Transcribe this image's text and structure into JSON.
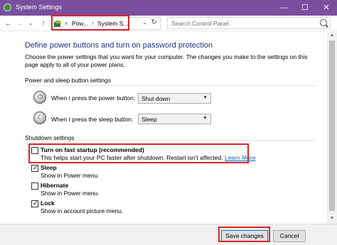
{
  "window": {
    "title": "System Settings",
    "minimize": "—",
    "maximize": "☐",
    "close": "✕"
  },
  "nav": {
    "back_icon": "←",
    "forward_icon": "→",
    "recent_icon": "⌄",
    "up_icon": "↑",
    "breadcrumb_prefix": "«",
    "crumbs": [
      "Pow...",
      "System S..."
    ],
    "separator": "›",
    "dropdown_icon": "⌄",
    "refresh_icon": "↻",
    "search_placeholder": "Search Control Panel"
  },
  "main": {
    "heading": "Define power buttons and turn on password protection",
    "description": "Choose the power settings that you want for your computer. The changes you make to the settings on this page apply to all of your power plans.",
    "power_group": {
      "title": "Power and sleep button settings",
      "power_button": {
        "label": "When I press the power button:",
        "value": "Shut down",
        "icon": "power-icon"
      },
      "sleep_button": {
        "label": "When I press the sleep button:",
        "value": "Sleep",
        "icon": "moon-icon"
      }
    },
    "shutdown_group": {
      "title": "Shutdown settings",
      "items": [
        {
          "label": "Turn on fast startup (recommended)",
          "desc": "This helps start your PC faster after shutdown. Restart isn't affected.",
          "link": "Learn More",
          "checked": false
        },
        {
          "label": "Sleep",
          "desc": "Show in Power menu.",
          "checked": true
        },
        {
          "label": "Hibernate",
          "desc": "Show in Power menu.",
          "checked": false
        },
        {
          "label": "Lock",
          "desc": "Show in account picture menu.",
          "checked": true
        }
      ]
    }
  },
  "footer": {
    "save_label": "Save changes",
    "cancel_label": "Cancel"
  },
  "colors": {
    "titlebar": "#7b4f9d",
    "heading": "#1e3287",
    "highlight": "#d9262b",
    "link": "#0066cc"
  }
}
